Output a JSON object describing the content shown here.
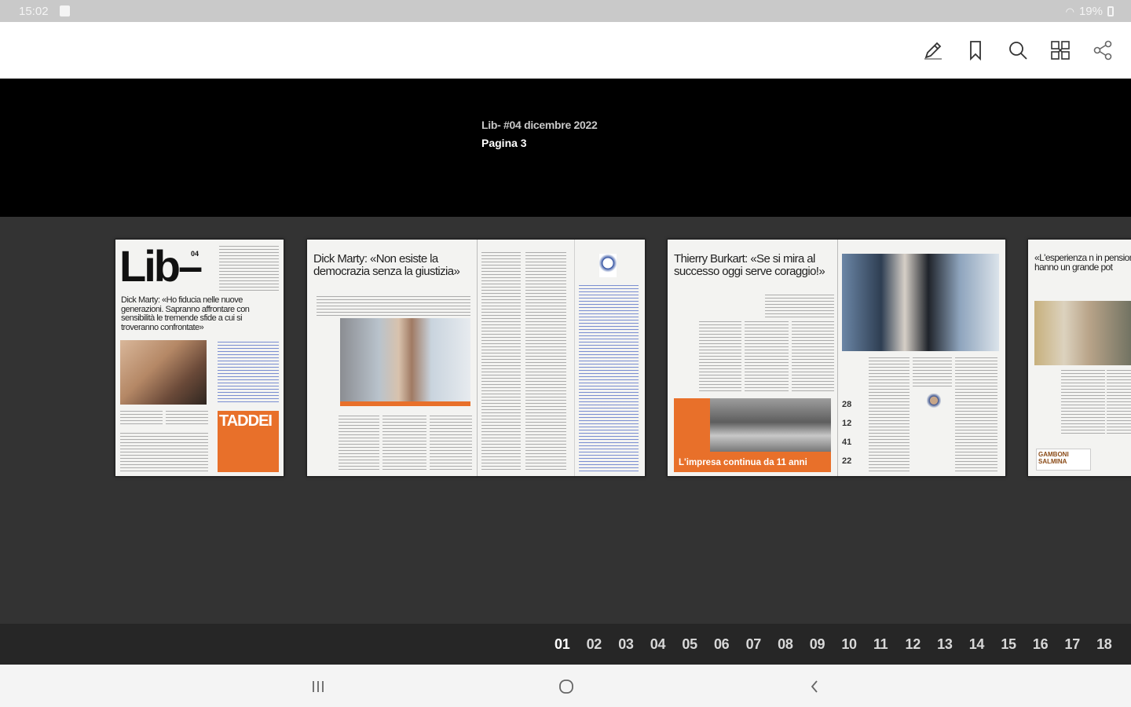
{
  "status_bar": {
    "time": "15:02",
    "battery": "19%",
    "icons": [
      "notification-icon",
      "wifi-icon",
      "battery-icon"
    ]
  },
  "toolbar": {
    "icons": [
      "pencil-icon",
      "bookmark-icon",
      "search-icon",
      "grid-view-icon",
      "share-icon"
    ]
  },
  "header": {
    "issue_title": "Lib- #04 dicembre 2022",
    "page_label": "Pagina 3"
  },
  "thumbnails": [
    {
      "masthead": "Lib–",
      "issue_number": "04",
      "headline": "Dick Marty: «Ho fiducia nelle nuove generazioni. Sapranno affrontare con sensibilità le tremende sfide a cui si troveranno confrontate»",
      "ad_text": "TADDEI"
    },
    {
      "headline": "Dick Marty: «Non esiste la democrazia senza la giustizia»"
    },
    {
      "headline": "Thierry Burkart: «Se si mira al successo oggi serve coraggio!»",
      "banner_text": "L'impresa continua da 11 anni",
      "stats": [
        "28",
        "12",
        "41",
        "22"
      ]
    },
    {
      "headline": "«L'esperienza n in pensione e anche c hanno un grande pot",
      "ad_text": "GAMBONI SALMINA"
    }
  ],
  "pages": [
    "01",
    "02",
    "03",
    "04",
    "05",
    "06",
    "07",
    "08",
    "09",
    "10",
    "11",
    "12",
    "13",
    "14",
    "15",
    "16",
    "17",
    "18"
  ],
  "active_page": "01",
  "navigation": {
    "icons": [
      "recent-apps-icon",
      "home-icon",
      "back-icon"
    ]
  }
}
